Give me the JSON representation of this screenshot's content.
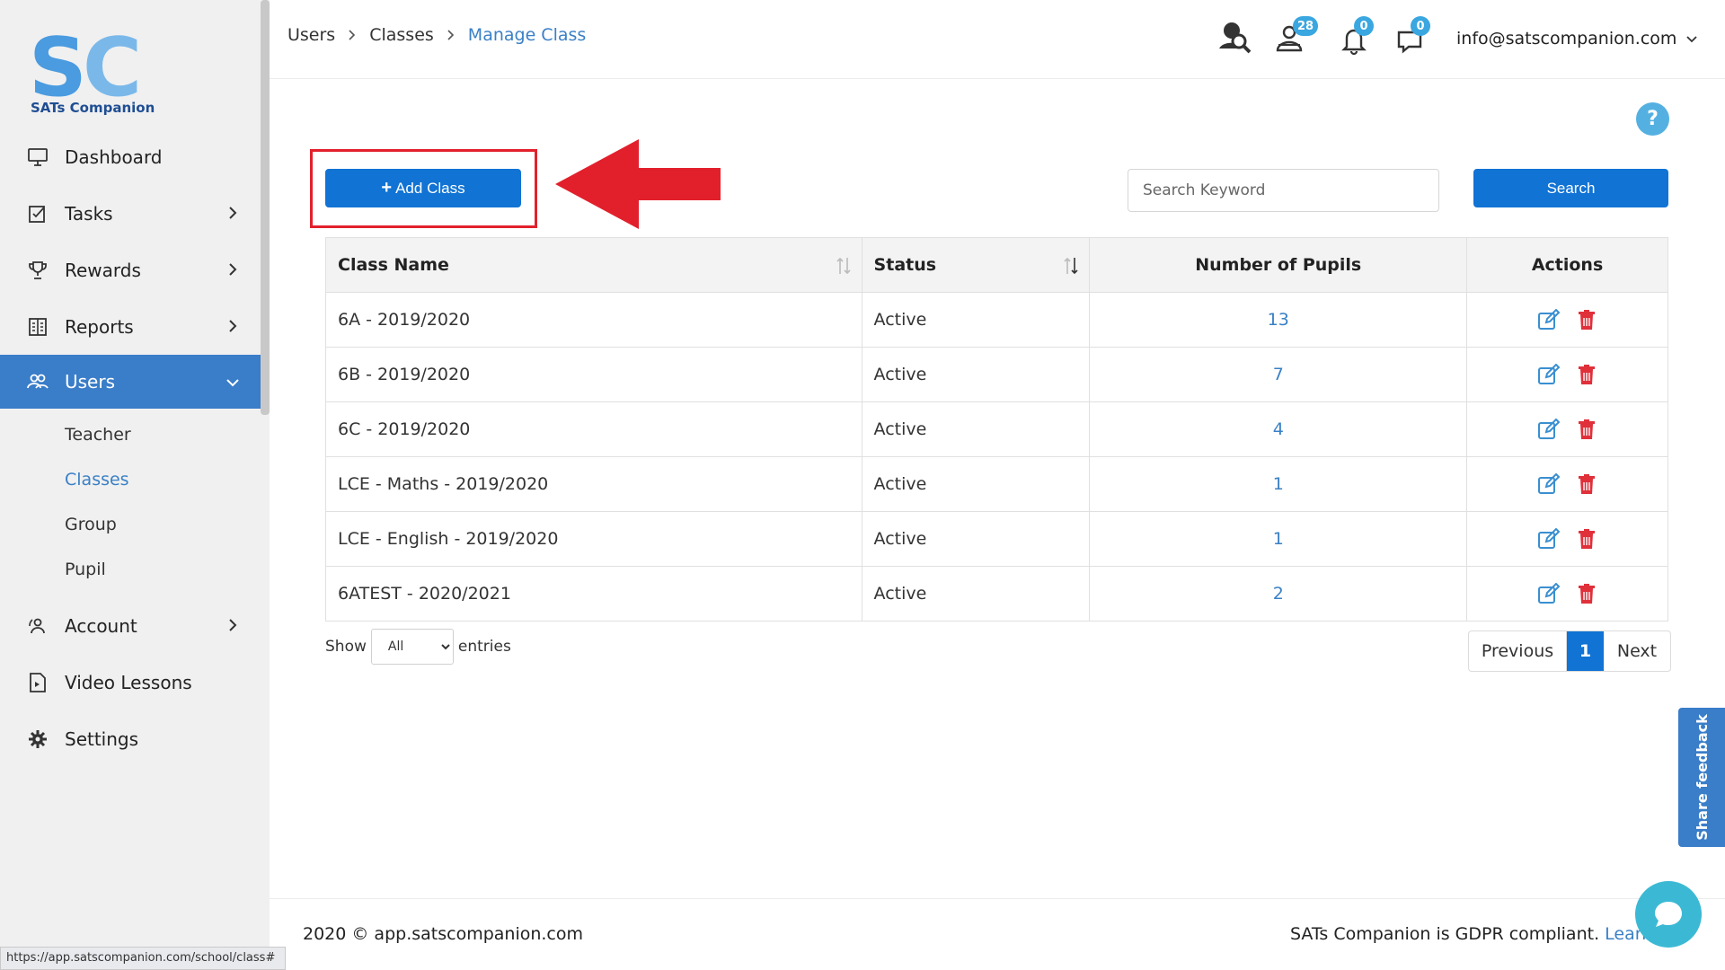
{
  "brand": {
    "name": "SATs Companion",
    "logo_letters": "SC"
  },
  "sidebar": {
    "items": [
      {
        "label": "Dashboard",
        "icon": "monitor-icon"
      },
      {
        "label": "Tasks",
        "icon": "tasks-icon"
      },
      {
        "label": "Rewards",
        "icon": "trophy-icon"
      },
      {
        "label": "Reports",
        "icon": "reports-icon"
      },
      {
        "label": "Users",
        "icon": "users-icon"
      },
      {
        "label": "Account",
        "icon": "account-icon"
      },
      {
        "label": "Video Lessons",
        "icon": "video-lessons-icon"
      },
      {
        "label": "Settings",
        "icon": "gear-icon"
      }
    ],
    "users_subitems": [
      "Teacher",
      "Classes",
      "Group",
      "Pupil"
    ]
  },
  "header": {
    "breadcrumb": [
      "Users",
      "Classes",
      "Manage Class"
    ],
    "badges": {
      "users": "28",
      "notifications": "0",
      "messages": "0"
    },
    "email": "info@satscompanion.com"
  },
  "toolbar": {
    "add_label": "Add Class",
    "search_placeholder": "Search Keyword",
    "search_label": "Search",
    "help_label": "?"
  },
  "table": {
    "headers": [
      "Class Name",
      "Status",
      "Number of Pupils",
      "Actions"
    ],
    "rows": [
      {
        "name": "6A - 2019/2020",
        "status": "Active",
        "pupils": "13"
      },
      {
        "name": "6B - 2019/2020",
        "status": "Active",
        "pupils": "7"
      },
      {
        "name": "6C - 2019/2020",
        "status": "Active",
        "pupils": "4"
      },
      {
        "name": "LCE - Maths - 2019/2020",
        "status": "Active",
        "pupils": "1"
      },
      {
        "name": "LCE - English - 2019/2020",
        "status": "Active",
        "pupils": "1"
      },
      {
        "name": "6ATEST - 2020/2021",
        "status": "Active",
        "pupils": "2"
      }
    ]
  },
  "entries": {
    "show_label": "Show",
    "selected": "All",
    "entries_label": "entries"
  },
  "pagination": {
    "previous": "Previous",
    "current": "1",
    "next": "Next"
  },
  "feedback_label": "Share feedback",
  "footer": {
    "copyright": "2020 © app.satscompanion.com",
    "gdpr": "SATs Companion is GDPR compliant.",
    "learn": "Learn"
  },
  "statusbar_url": "https://app.satscompanion.com/school/class#",
  "colors": {
    "primary": "#1173d4",
    "active_nav": "#3a7dc8",
    "link": "#3a80c6",
    "highlight": "#e2202c",
    "delete": "#e0303a"
  }
}
